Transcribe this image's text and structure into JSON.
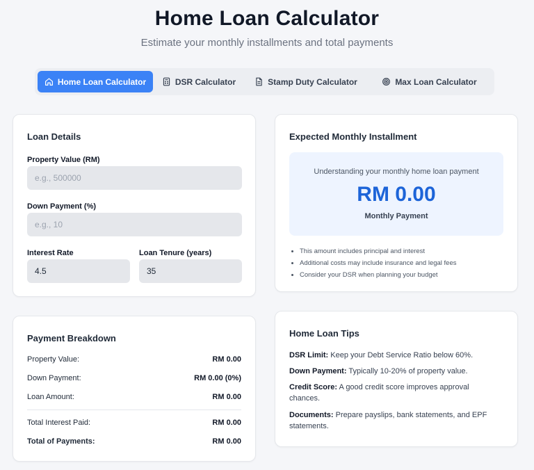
{
  "header": {
    "title": "Home Loan Calculator",
    "subtitle": "Estimate your monthly installments and total payments"
  },
  "tabs": [
    {
      "label": "Home Loan Calculator",
      "icon": "home-icon",
      "active": true
    },
    {
      "label": "DSR Calculator",
      "icon": "calculator-icon",
      "active": false
    },
    {
      "label": "Stamp Duty Calculator",
      "icon": "document-icon",
      "active": false
    },
    {
      "label": "Max Loan Calculator",
      "icon": "target-icon",
      "active": false
    }
  ],
  "loan_details": {
    "title": "Loan Details",
    "property_value": {
      "label": "Property Value (RM)",
      "value": "",
      "placeholder": "e.g., 500000"
    },
    "down_payment": {
      "label": "Down Payment (%)",
      "value": "",
      "placeholder": "e.g., 10"
    },
    "interest_rate": {
      "label": "Interest Rate",
      "value": "4.5"
    },
    "loan_tenure": {
      "label": "Loan Tenure (years)",
      "value": "35"
    }
  },
  "installment": {
    "title": "Expected Monthly Installment",
    "description": "Understanding your monthly home loan payment",
    "amount": "RM 0.00",
    "caption": "Monthly Payment",
    "notes": [
      "This amount includes principal and interest",
      "Additional costs may include insurance and legal fees",
      "Consider your DSR when planning your budget"
    ]
  },
  "breakdown": {
    "title": "Payment Breakdown",
    "rows": [
      {
        "label": "Property Value:",
        "value": "RM 0.00"
      },
      {
        "label": "Down Payment:",
        "value": "RM 0.00 (0%)"
      },
      {
        "label": "Loan Amount:",
        "value": "RM 0.00"
      },
      {
        "label": "Total Interest Paid:",
        "value": "RM 0.00"
      },
      {
        "label": "Total of Payments:",
        "value": "RM 0.00"
      }
    ]
  },
  "tips": {
    "title": "Home Loan Tips",
    "items": [
      {
        "term": "DSR Limit:",
        "text": " Keep your Debt Service Ratio below 60%."
      },
      {
        "term": "Down Payment:",
        "text": " Typically 10-20% of property value."
      },
      {
        "term": "Credit Score:",
        "text": " A good credit score improves approval chances."
      },
      {
        "term": "Documents:",
        "text": " Prepare payslips, bank statements, and EPF statements."
      }
    ]
  },
  "colors": {
    "accent": "#3b82f6",
    "amount": "#1d64d8",
    "installment_bg": "#eef4ff"
  }
}
